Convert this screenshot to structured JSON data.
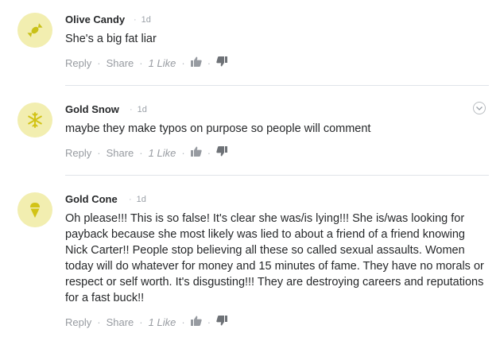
{
  "colors": {
    "avatar_bg": "#f2eeb0",
    "avatar_icon": "#c9c117",
    "meta": "#979ba1"
  },
  "comments": [
    {
      "author": "Olive Candy",
      "time": "1d",
      "avatar_icon": "candy-icon",
      "text": "She's a big fat liar",
      "reply": "Reply",
      "share": "Share",
      "likes": "1 Like"
    },
    {
      "author": "Gold Snow",
      "time": "1d",
      "avatar_icon": "snowflake-icon",
      "text": "maybe they make typos on purpose so people will comment",
      "reply": "Reply",
      "share": "Share",
      "likes": "1 Like"
    },
    {
      "author": "Gold Cone",
      "time": "1d",
      "avatar_icon": "ice-cream-cone-icon",
      "text": "Oh please!!! This is so false! It's clear she was/is lying!!! She is/was looking for payback because she most likely was lied to about a friend of a friend knowing Nick Carter!! People stop believing all these so called sexual assaults. Women today will do whatever for money and 15 minutes of fame. They have no morals or respect or self worth. It's disgusting!!! They are destroying careers and reputations for a fast buck!!",
      "reply": "Reply",
      "share": "Share",
      "likes": "1 Like"
    }
  ]
}
